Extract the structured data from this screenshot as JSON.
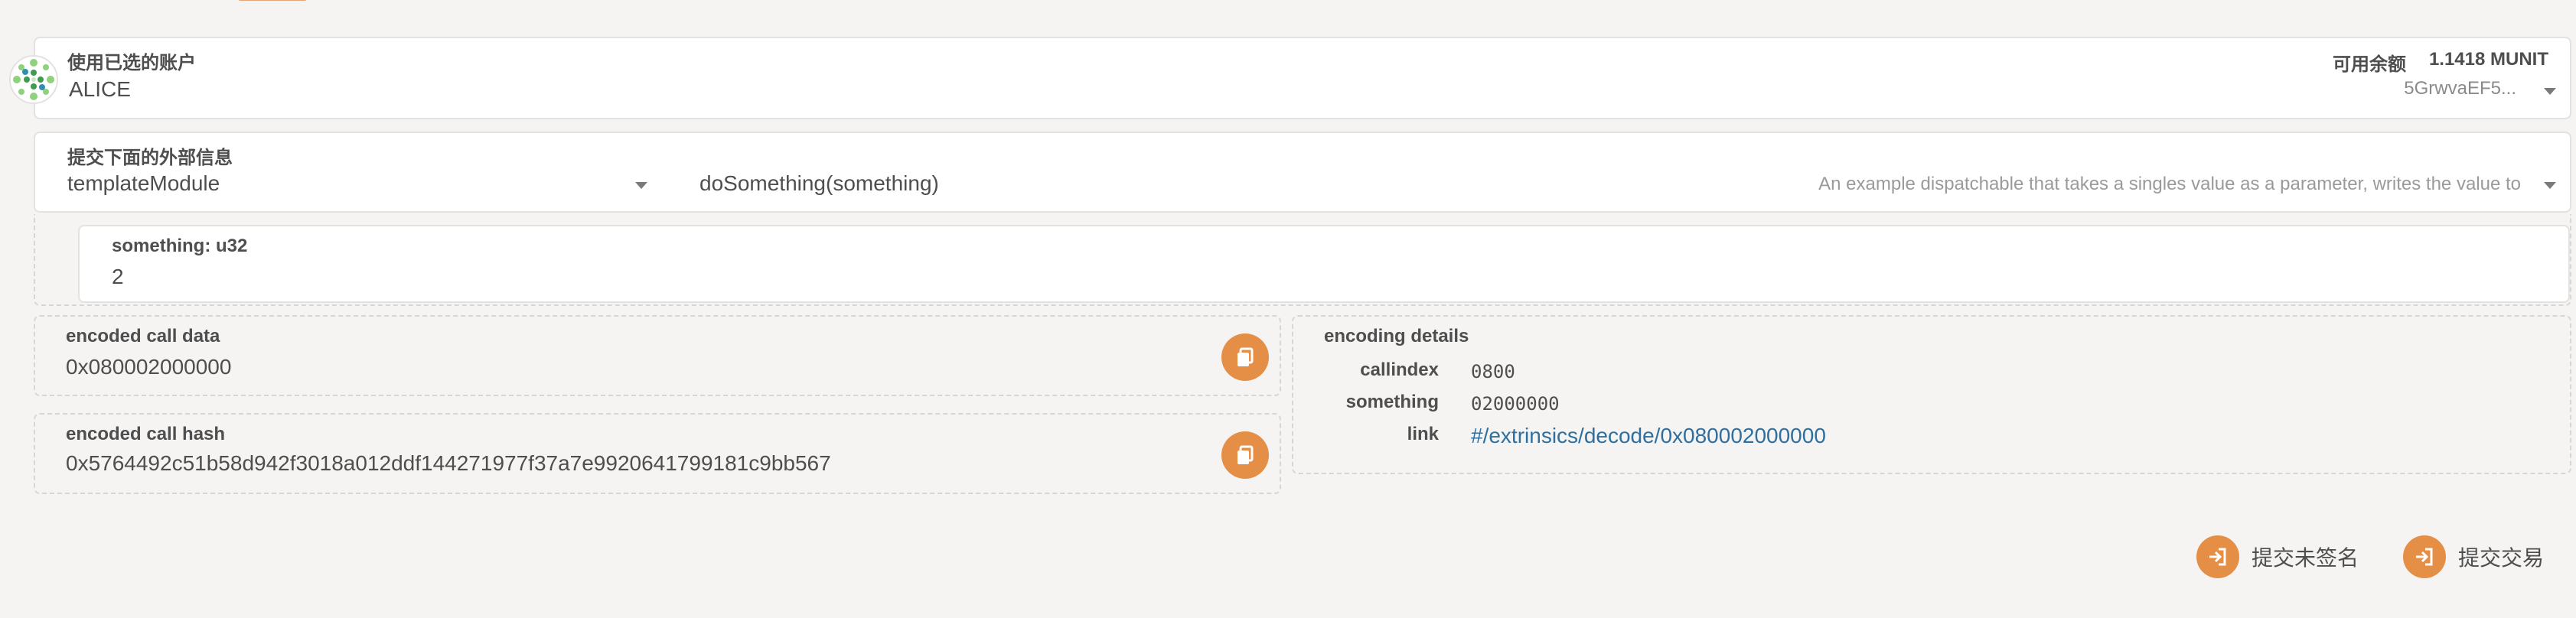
{
  "account": {
    "label": "使用已选的账户",
    "name": "ALICE",
    "balance_label": "可用余额",
    "balance_value": "1.1418 MUNIT",
    "address": "5GrwvaEF5..."
  },
  "extrinsic": {
    "label": "提交下面的外部信息",
    "module": "templateModule",
    "method": "doSomething(something)",
    "description": "An example dispatchable that takes a singles value as a parameter, writes the value to"
  },
  "param": {
    "label": "something: u32",
    "value": "2"
  },
  "encoded_call_data": {
    "label": "encoded call data",
    "value": "0x080002000000"
  },
  "encoded_call_hash": {
    "label": "encoded call hash",
    "value": "0x5764492c51b58d942f3018a012ddf144271977f37a7e9920641799181c9bb567"
  },
  "encoding_details": {
    "title": "encoding details",
    "callindex_label": "callindex",
    "callindex_value": "0800",
    "something_label": "something",
    "something_value": "02000000",
    "link_label": "link",
    "link_value": "#/extrinsics/decode/0x080002000000"
  },
  "actions": {
    "submit_unsigned": "提交未签名",
    "submit_transaction": "提交交易"
  },
  "colors": {
    "accent": "#e58e46",
    "link": "#2f6f9f",
    "card_border": "#e4e2e0",
    "background": "#f5f4f3"
  },
  "icons": {
    "avatar": "identicon",
    "copy": "copy-icon",
    "chevron": "chevron-down-icon",
    "sign_in": "sign-in-icon"
  }
}
